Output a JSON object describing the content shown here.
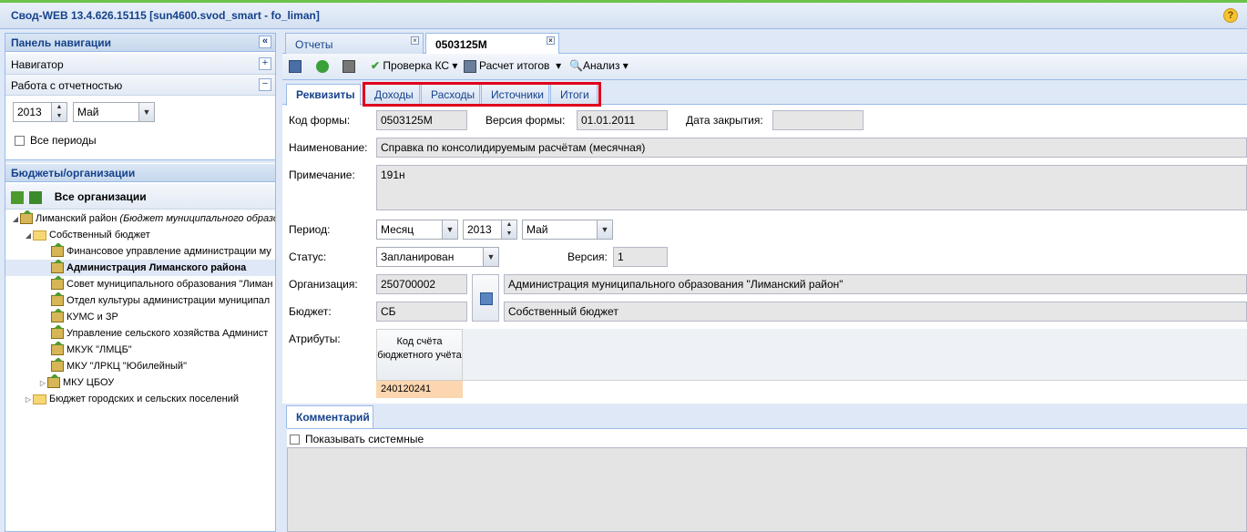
{
  "app": {
    "title": "Свод-WEB 13.4.626.15115 [sun4600.svod_smart - fo_liman]"
  },
  "nav": {
    "panel_title": "Панель навигации",
    "navigator": "Навигатор",
    "reporting": "Работа с отчетностью",
    "year": "2013",
    "month": "Май",
    "all_periods": "Все периоды",
    "budgets_title": "Бюджеты/организации",
    "all_orgs": "Все организации",
    "tree": [
      {
        "label": "Лиманский район",
        "note": "(Бюджет муниципального образо"
      },
      {
        "label": "Собственный бюджет"
      },
      {
        "label": "Финансовое управление администрации му"
      },
      {
        "label": "Администрация Лиманского района"
      },
      {
        "label": "Совет муниципального образования \"Лиман"
      },
      {
        "label": "Отдел культуры администрации муниципал"
      },
      {
        "label": "КУМС и ЗР"
      },
      {
        "label": "Управление сельского хозяйства Админист"
      },
      {
        "label": "МКУК \"ЛМЦБ\""
      },
      {
        "label": "МКУ \"ЛРКЦ \"Юбилейный\""
      },
      {
        "label": "МКУ ЦБОУ"
      },
      {
        "label": "Бюджет городских и сельских поселений"
      }
    ]
  },
  "tabs": {
    "reports": "Отчеты",
    "form": "0503125М"
  },
  "toolbar": {
    "check": "Проверка КС",
    "totals": "Расчет итогов",
    "analysis": "Анализ"
  },
  "subtabs": {
    "props": "Реквизиты",
    "income": "Доходы",
    "expense": "Расходы",
    "sources": "Источники",
    "totals": "Итоги"
  },
  "form": {
    "code_label": "Код формы:",
    "code": "0503125М",
    "version_label": "Версия формы:",
    "version": "01.01.2011",
    "close_label": "Дата закрытия:",
    "close": "",
    "name_label": "Наименование:",
    "name": "Справка по консолидируемым расчётам (месячная)",
    "note_label": "Примечание:",
    "note": "191н",
    "period_label": "Период:",
    "period_type": "Месяц",
    "period_year": "2013",
    "period_month": "Май",
    "status_label": "Статус:",
    "status": "Запланирован",
    "ver_label": "Версия:",
    "ver": "1",
    "org_label": "Организация:",
    "org_code": "250700002",
    "org_name": "Администрация муниципального образования \"Лиманский район\"",
    "budget_label": "Бюджет:",
    "budget_code": "СБ",
    "budget_name": "Собственный бюджет",
    "attr_label": "Атрибуты:",
    "attr_col": "Код счёта бюджетного учёта",
    "attr_val": "240120241"
  },
  "comments": {
    "tab": "Комментарий",
    "show_system": "Показывать системные"
  }
}
